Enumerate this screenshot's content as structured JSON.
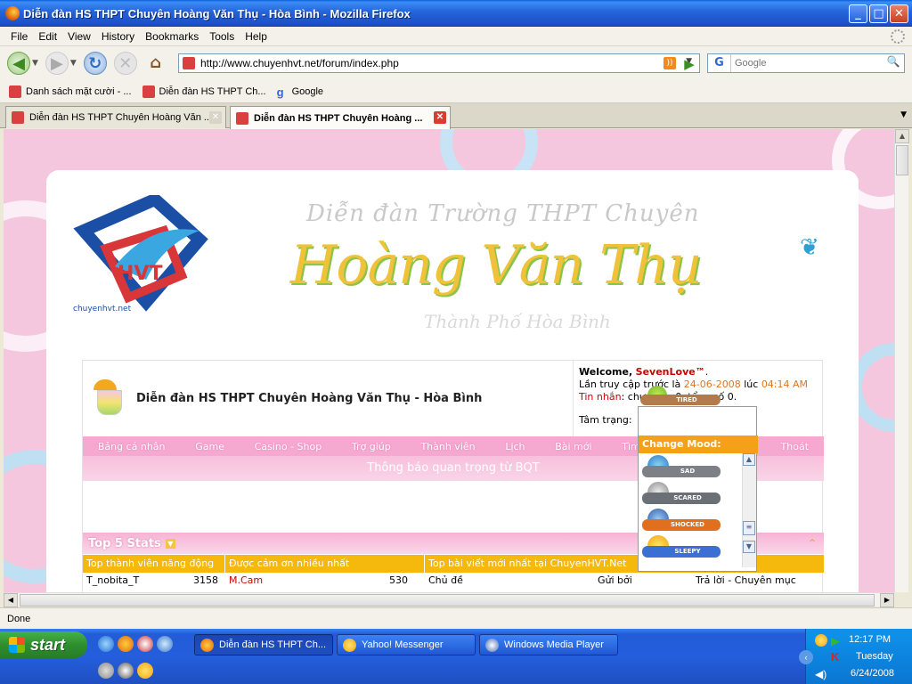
{
  "window": {
    "title": "Diễn đàn HS THPT Chuyên Hoàng Văn Thụ - Hòa Bình - Mozilla Firefox"
  },
  "menubar": [
    "File",
    "Edit",
    "View",
    "History",
    "Bookmarks",
    "Tools",
    "Help"
  ],
  "address": {
    "url": "http://www.chuyenhvt.net/forum/index.php"
  },
  "search": {
    "placeholder": "Google",
    "engine": "G"
  },
  "bookmarks": [
    {
      "label": "Danh sách mặt cười - ..."
    },
    {
      "label": "Diễn đàn HS THPT Ch..."
    },
    {
      "label": "Google"
    }
  ],
  "tabs": [
    {
      "label": "Diễn đàn HS THPT Chuyên Hoàng Văn ...",
      "active": false
    },
    {
      "label": "Diễn đàn HS THPT Chuyên Hoàng ...",
      "active": true
    }
  ],
  "page": {
    "banner": {
      "line1": "Diễn đàn Trường THPT Chuyên",
      "line2": "Hoàng Văn Thụ",
      "line3": "Thành Phố Hòa Bình",
      "logo_text": "chuyenhvt.net"
    },
    "forum_name": "Diễn đàn HS THPT Chuyên Hoàng Văn Thụ - Hòa Bình",
    "user": {
      "welcome": "Welcome,",
      "name": "SevenLove™",
      "last_visit_label": "Lần truy cập trước là",
      "last_visit_date": "24-06-2008",
      "at": "lúc",
      "last_visit_time": "04:14 AM",
      "pm_label": "Tin nhắn",
      "pm_text": ": chưa đọc 0, tổng số 0.",
      "mood_label": "Tâm trạng:"
    },
    "menu": [
      "Bảng cá nhân",
      "Game",
      "Casino - Shop",
      "Trợ giúp",
      "Thành viên",
      "Lịch",
      "Bài mới",
      "Tìm kiếm",
      "Thoát"
    ],
    "notice": "Thông báo quan trọng từ BQT",
    "stats": {
      "title": "Top 5 Stats",
      "headers": [
        "Top thành viên năng động",
        "Được cảm ơn nhiều nhất",
        "Top bài viết mới nhất tại ChuyenHVT.Net"
      ],
      "row": [
        "T_nobita_T",
        "3158",
        "M.Cam",
        "530",
        "Chủ đề",
        "Gửi bởi",
        "Trả lời - Chuyên mục"
      ]
    },
    "mood_popup": {
      "current": "TIRED",
      "header": "Change Mood:",
      "items": [
        {
          "label": "SAD",
          "color": "#7d8187"
        },
        {
          "label": "SCARED",
          "color": "#6b6f76"
        },
        {
          "label": "SHOCKED",
          "color": "#e0701f"
        },
        {
          "label": "SLEEPY",
          "color": "#3c6fd3"
        }
      ]
    }
  },
  "status": {
    "text": "Done"
  },
  "taskbar": {
    "start_label": "start",
    "buttons": [
      {
        "label": "Diễn đàn HS THPT Ch...",
        "active": true
      },
      {
        "label": "Yahoo! Messenger",
        "active": false
      },
      {
        "label": "Windows Media Player",
        "active": false
      }
    ],
    "clock": {
      "time": "12:17 PM",
      "day": "Tuesday",
      "date": "6/24/2008"
    }
  }
}
